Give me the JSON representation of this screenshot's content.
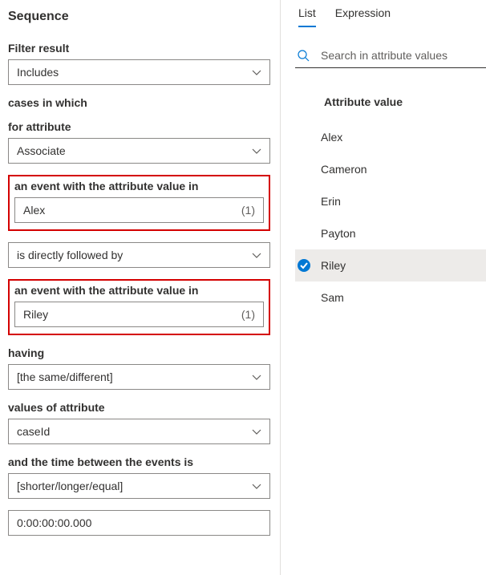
{
  "left": {
    "title": "Sequence",
    "filter_result_label": "Filter result",
    "filter_result_value": "Includes",
    "cases_in_which": "cases in which",
    "for_attribute_label": "for attribute",
    "for_attribute_value": "Associate",
    "event1_label": "an event with the attribute value in",
    "event1_value": "Alex",
    "event1_count": "(1)",
    "relation_value": "is directly followed by",
    "event2_label": "an event with the attribute value in",
    "event2_value": "Riley",
    "event2_count": "(1)",
    "having_label": "having",
    "having_value": "[the same/different]",
    "values_of_attr_label": "values of attribute",
    "values_of_attr_value": "caseId",
    "time_between_label": "and the time between the events is",
    "time_between_value": "[shorter/longer/equal]",
    "duration_value": "0:00:00:00.000"
  },
  "right": {
    "tab_list": "List",
    "tab_expression": "Expression",
    "search_placeholder": "Search in attribute values",
    "attr_header": "Attribute value",
    "items": [
      {
        "label": "Alex"
      },
      {
        "label": "Cameron"
      },
      {
        "label": "Erin"
      },
      {
        "label": "Payton"
      },
      {
        "label": "Riley"
      },
      {
        "label": "Sam"
      }
    ]
  }
}
